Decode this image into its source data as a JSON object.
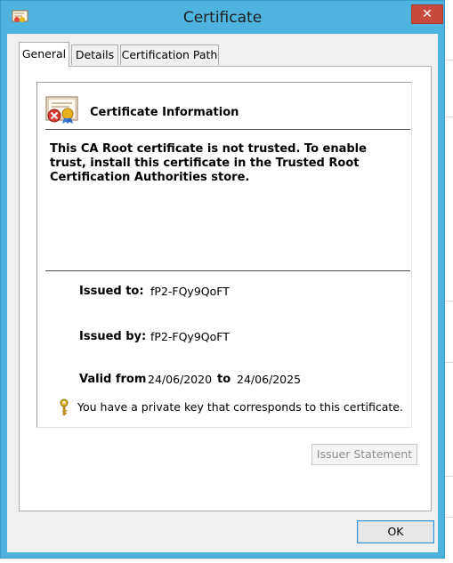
{
  "window": {
    "title": "Certificate",
    "close_label": "✕"
  },
  "tabs": [
    {
      "label": "General",
      "active": true
    },
    {
      "label": "Details",
      "active": false
    },
    {
      "label": "Certification Path",
      "active": false
    }
  ],
  "info": {
    "heading": "Certificate Information",
    "warning": "This CA Root certificate is not trusted. To enable trust, install this certificate in the Trusted Root Certification Authorities store."
  },
  "fields": {
    "issued_to_label": "Issued to:",
    "issued_to_value": "fP2-FQy9QoFT",
    "issued_by_label": "Issued by:",
    "issued_by_value": "fP2-FQy9QoFT",
    "valid_from_label": "Valid from",
    "valid_from_value": "24/06/2020",
    "valid_to_label": "to",
    "valid_to_value": "24/06/2025"
  },
  "private_key_note": "You have a private key that corresponds to this certificate.",
  "buttons": {
    "issuer_statement": "Issuer Statement",
    "ok": "OK"
  },
  "icons": {
    "app": "certificate-icon",
    "cert_info": "untrusted-certificate-icon",
    "key": "key-icon"
  },
  "colors": {
    "frame": "#4fb3e0",
    "close": "#c74a3d",
    "ok_border": "#3c90d6"
  }
}
